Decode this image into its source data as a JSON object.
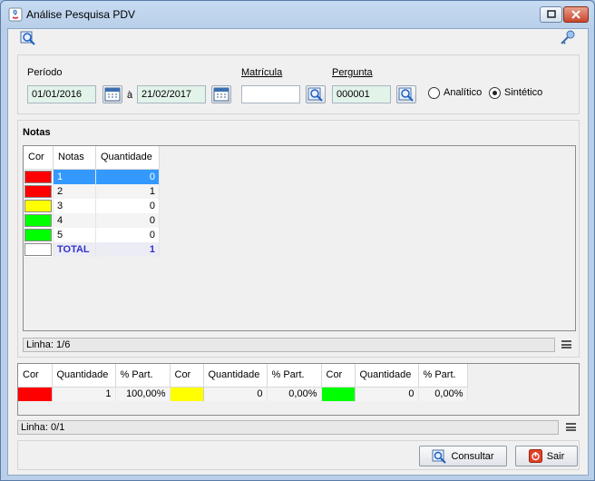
{
  "window": {
    "title": "Análise Pesquisa PDV"
  },
  "filters": {
    "periodo_label": "Período",
    "date_from": "01/01/2016",
    "date_sep": "à",
    "date_to": "21/02/2017",
    "matricula_label": "Matrícula",
    "matricula_value": "",
    "pergunta_label": "Pergunta",
    "pergunta_value": "000001",
    "radio_analitico": "Analítico",
    "radio_sintetico": "Sintético",
    "selected_mode": "Sintético"
  },
  "notas": {
    "section_title": "Notas",
    "columns": [
      "Cor",
      "Notas",
      "Quantidade"
    ],
    "rows": [
      {
        "color": "#ff0000",
        "nota": "1",
        "quantidade": "0",
        "selected": true
      },
      {
        "color": "#ff0000",
        "nota": "2",
        "quantidade": "1"
      },
      {
        "color": "#ffff00",
        "nota": "3",
        "quantidade": "0"
      },
      {
        "color": "#00ff00",
        "nota": "4",
        "quantidade": "0"
      },
      {
        "color": "#00ff00",
        "nota": "5",
        "quantidade": "0"
      },
      {
        "color": "#ffffff",
        "nota": "TOTAL",
        "quantidade": "1",
        "total": true
      }
    ],
    "status": "Linha: 1/6"
  },
  "summary": {
    "columns": [
      "Cor",
      "Quantidade",
      "% Part.",
      "Cor",
      "Quantidade",
      "% Part.",
      "Cor",
      "Quantidade",
      "% Part."
    ],
    "row": [
      {
        "color": "#ff0000",
        "quantidade": "1",
        "part": "100,00%"
      },
      {
        "color": "#ffff00",
        "quantidade": "0",
        "part": "0,00%"
      },
      {
        "color": "#00ff00",
        "quantidade": "0",
        "part": "0,00%"
      }
    ],
    "status": "Linha: 0/1"
  },
  "buttons": {
    "consultar": "Consultar",
    "sair": "Sair"
  },
  "colors": {
    "selection": "#3399ff",
    "total_text": "#3333cc"
  }
}
